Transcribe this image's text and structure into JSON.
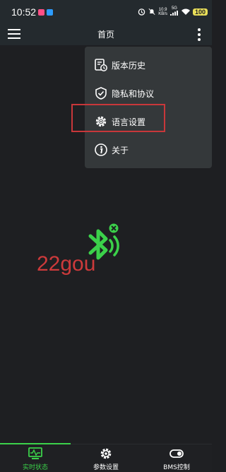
{
  "status_bar": {
    "time": "10:52",
    "net_speed_value": "10.9",
    "net_speed_unit": "KB/s",
    "network_type": "5G",
    "battery": "100"
  },
  "header": {
    "title": "首页"
  },
  "menu": {
    "items": [
      {
        "label": "版本历史",
        "icon": "version-history-icon"
      },
      {
        "label": "隐私和协议",
        "icon": "shield-icon"
      },
      {
        "label": "语言设置",
        "icon": "gear-icon"
      },
      {
        "label": "关于",
        "icon": "info-icon"
      }
    ]
  },
  "watermark": "22gou",
  "bottom_nav": {
    "tabs": [
      {
        "label": "实时状态",
        "icon": "monitor-icon",
        "active": true
      },
      {
        "label": "参数设置",
        "icon": "gear-icon",
        "active": false
      },
      {
        "label": "BMS控制",
        "icon": "toggle-icon",
        "active": false
      }
    ]
  },
  "colors": {
    "accent": "#3bd14a",
    "highlight": "#c8373a",
    "battery": "#e9df5a",
    "menu_bg": "#34383a"
  }
}
